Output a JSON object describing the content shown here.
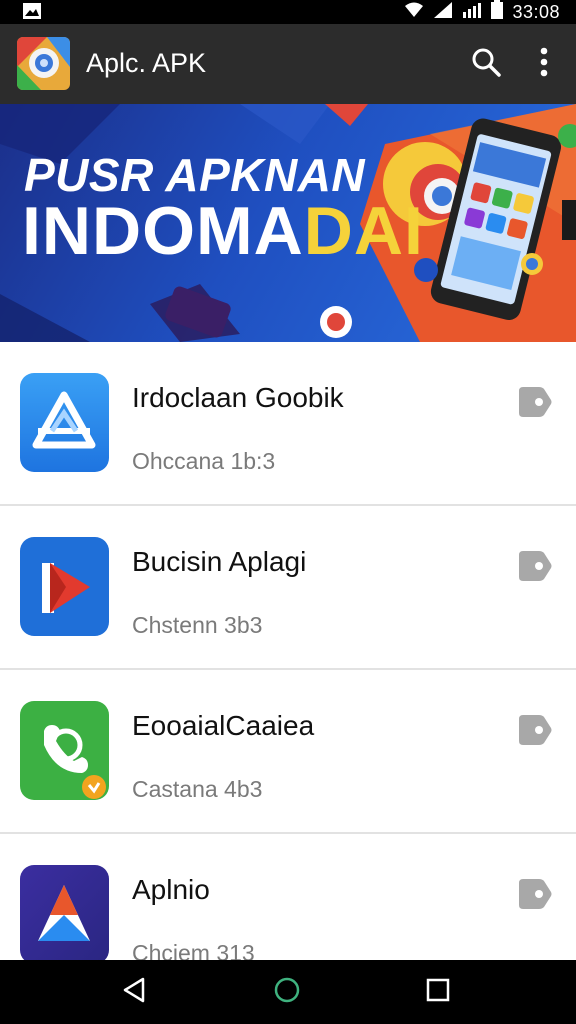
{
  "status_bar": {
    "time": "33:08"
  },
  "app_bar": {
    "title": "Aplc. APK"
  },
  "banner": {
    "line1": "PUSR APKNAN",
    "line2_main": "INDOMA",
    "line2_accent": "DAI"
  },
  "apps": [
    {
      "name": "Irdoclaan Goobik",
      "subtitle": "Ohccana 1b:3",
      "icon": "triangle-a-app-icon",
      "icon_color": "#2a8cf0"
    },
    {
      "name": "Bucisin Aplagi",
      "subtitle": "Chstenn 3b3",
      "icon": "play-arrow-app-icon",
      "icon_color": "#1f6fd8"
    },
    {
      "name": "EooaialCaaiea",
      "subtitle": "Castana 4b3",
      "icon": "phone-app-icon",
      "icon_color": "#3cb043"
    },
    {
      "name": "Aplnio",
      "subtitle": "Chciem 313",
      "icon": "arrow-a-app-icon",
      "icon_color": "#3a2f9a"
    }
  ],
  "colors": {
    "app_bar": "#2c2c2c",
    "status_bar": "#000000",
    "nav_bar": "#000000",
    "nav_home": "#3fb27f"
  }
}
